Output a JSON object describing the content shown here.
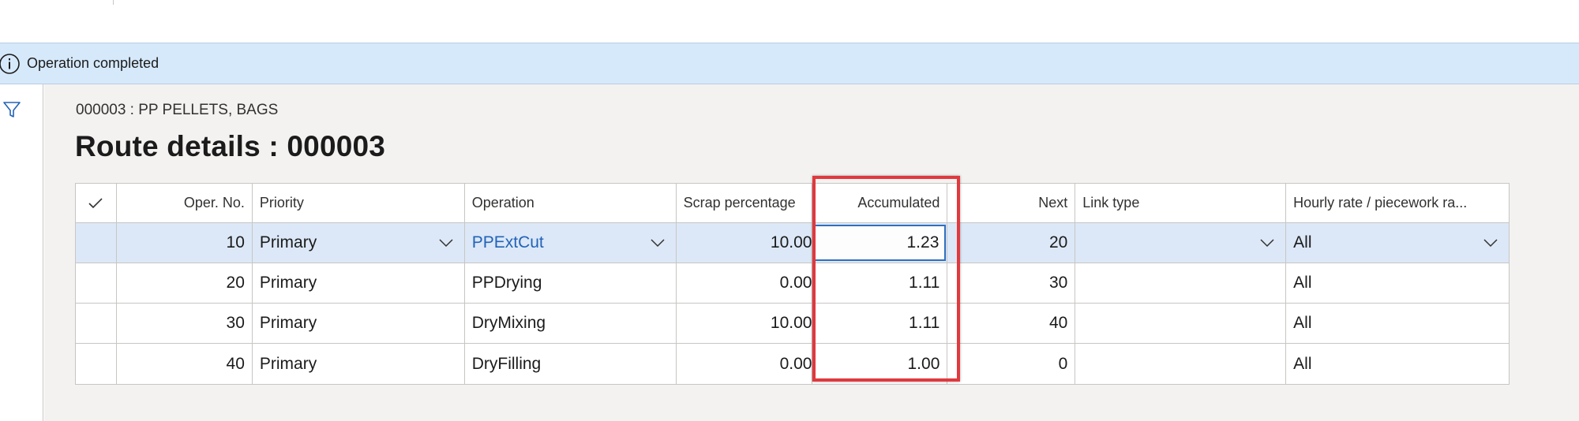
{
  "message": {
    "text": "Operation completed",
    "icon": "info-icon"
  },
  "rail": {
    "icon": "filter-icon"
  },
  "record": {
    "caption": "000003 : PP PELLETS, BAGS"
  },
  "page": {
    "title": "Route details : 000003"
  },
  "grid": {
    "headers": {
      "check": "✓",
      "oper_no": "Oper. No.",
      "priority": "Priority",
      "operation": "Operation",
      "scrap": "Scrap percentage",
      "accumulated": "Accumulated",
      "next": "Next",
      "link_type": "Link type",
      "hourly": "Hourly rate / piecework ra..."
    },
    "rows": [
      {
        "oper_no": "10",
        "priority": "Primary",
        "operation": "PPExtCut",
        "scrap": "10.00",
        "accumulated": "1.23",
        "next": "20",
        "link_type": "",
        "hourly": "All"
      },
      {
        "oper_no": "20",
        "priority": "Primary",
        "operation": "PPDrying",
        "scrap": "0.00",
        "accumulated": "1.11",
        "next": "30",
        "link_type": "",
        "hourly": "All"
      },
      {
        "oper_no": "30",
        "priority": "Primary",
        "operation": "DryMixing",
        "scrap": "10.00",
        "accumulated": "1.11",
        "next": "40",
        "link_type": "",
        "hourly": "All"
      },
      {
        "oper_no": "40",
        "priority": "Primary",
        "operation": "DryFilling",
        "scrap": "0.00",
        "accumulated": "1.00",
        "next": "0",
        "link_type": "",
        "hourly": "All"
      }
    ]
  },
  "colors": {
    "message_bar": "#d6e9fb",
    "selected_row": "#dce8f7",
    "link": "#2263b8",
    "highlight": "#e0393e",
    "focus_border": "#2f6fbf"
  }
}
